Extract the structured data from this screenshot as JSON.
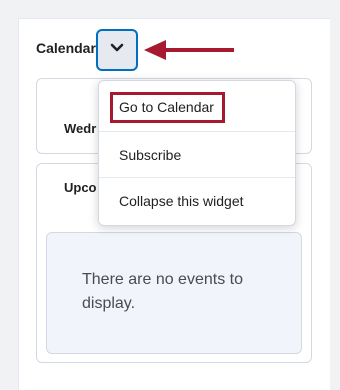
{
  "widget": {
    "title": "Calendar",
    "date_label": "Wedr",
    "upcoming_label": "Upco",
    "empty_message": "There are no events to display."
  },
  "menu": {
    "items": [
      {
        "label": "Go to Calendar",
        "icon": "go-to-calendar"
      },
      {
        "label": "Subscribe",
        "icon": "subscribe"
      },
      {
        "label": "Collapse this widget",
        "icon": "collapse-widget"
      }
    ]
  },
  "icons": {
    "toggle": "chevron-down-icon",
    "annotation": "arrow-left-icon"
  },
  "colors": {
    "accent": "#006fbf",
    "annotation": "#a6192e",
    "toggle_bg": "#e6eaf0",
    "text": "#202122",
    "muted_text": "#494c4e",
    "empty_bg": "#f1f5fb"
  }
}
